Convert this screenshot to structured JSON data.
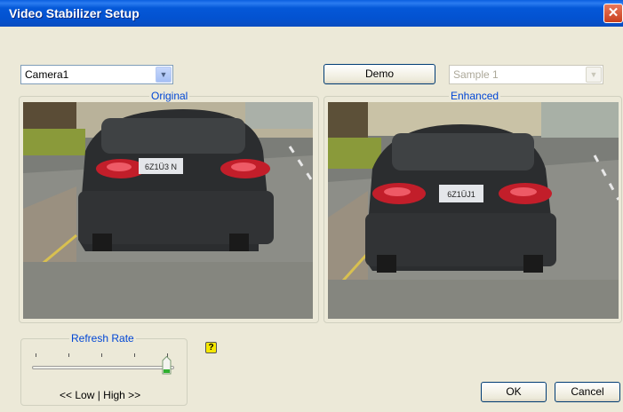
{
  "window": {
    "title": "Video Stabilizer Setup",
    "close_glyph": "✕"
  },
  "camera_select": {
    "value": "Camera1"
  },
  "demo_button": {
    "label": "Demo"
  },
  "sample_select": {
    "value": "Sample 1",
    "enabled": false
  },
  "original_panel": {
    "label": "Original",
    "plate": "6Z1Ü3 N"
  },
  "enhanced_panel": {
    "label": "Enhanced",
    "plate": "6Z1ÜJ1"
  },
  "refresh_rate": {
    "label": "Refresh Rate",
    "range_label": "<< Low | High >>",
    "value_fraction": 1.0
  },
  "help": {
    "glyph": "?"
  },
  "footer": {
    "ok_label": "OK",
    "cancel_label": "Cancel"
  },
  "colors": {
    "titlebar": "#0458d8",
    "group_label": "#0046d5",
    "dialog_bg": "#ece9d8"
  }
}
